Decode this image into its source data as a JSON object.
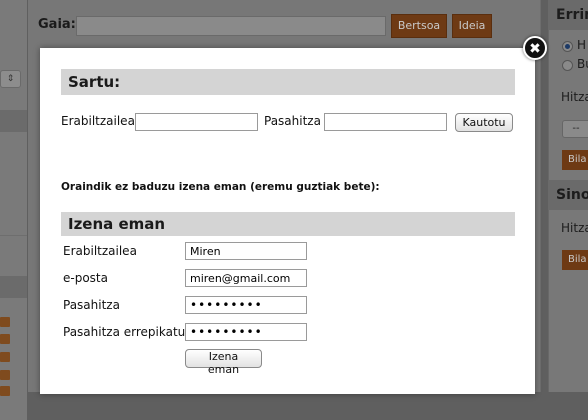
{
  "background": {
    "gaia_label": "Gaia:",
    "buttons": {
      "bertsoa": "Bertsoa",
      "ideia": "Ideia"
    },
    "right_panel": {
      "header1": "Errima",
      "radio1": "H",
      "radio2": "Bu",
      "field_label": "Hitza",
      "select_value": "--",
      "search_button": "Bila",
      "header2": "Sino",
      "field_label2": "Hitza",
      "search_button2": "Bila"
    }
  },
  "modal": {
    "login": {
      "title": "Sartu:",
      "username_label": "Erabiltzailea",
      "username_value": "",
      "password_label": "Pasahitza",
      "password_value": "",
      "submit_label": "Kautotu"
    },
    "note": "Oraindik ez baduzu izena eman (eremu guztiak bete):",
    "register": {
      "title": "Izena eman",
      "username_label": "Erabiltzailea",
      "username_value": "Miren",
      "email_label": "e-posta",
      "email_value": "miren@gmail.com",
      "password_label": "Pasahitza",
      "password_value": "•••••••••",
      "password_repeat_label": "Pasahitza errepikatu",
      "password_repeat_value": "•••••••••",
      "submit_label": "Izena eman"
    },
    "close_label": "✖"
  },
  "colors": {
    "overlay": "#5f5f5f",
    "section_header": "#d4d4d4",
    "accent_button": "#6e3a14"
  }
}
